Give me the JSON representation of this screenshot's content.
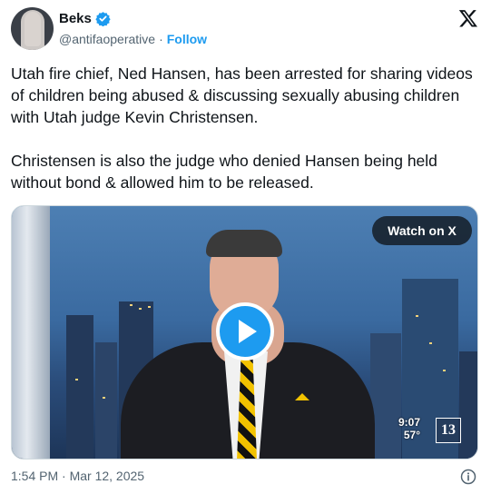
{
  "author": {
    "name": "Beks",
    "handle": "@antifaoperative",
    "separator": "·",
    "follow_label": "Follow"
  },
  "tweet": {
    "text": "Utah fire chief, Ned Hansen, has been arrested for sharing videos of children being abused & discussing sexually abusing children with Utah judge Kevin Christensen.\n\nChristensen is also the judge who denied Hansen being held without bond & allowed him to be released."
  },
  "media": {
    "watch_label": "Watch on X",
    "overlay_time": "9:07",
    "overlay_temp": "57°",
    "channel_badge": "13"
  },
  "footer": {
    "timestamp": "1:54 PM · Mar 12, 2025"
  },
  "icons": {
    "verified": "verified-badge-icon",
    "x_logo": "x-logo-icon",
    "play": "play-icon",
    "info": "info-icon"
  },
  "colors": {
    "accent": "#1d9bf0",
    "text": "#0f1419",
    "muted": "#536471"
  }
}
